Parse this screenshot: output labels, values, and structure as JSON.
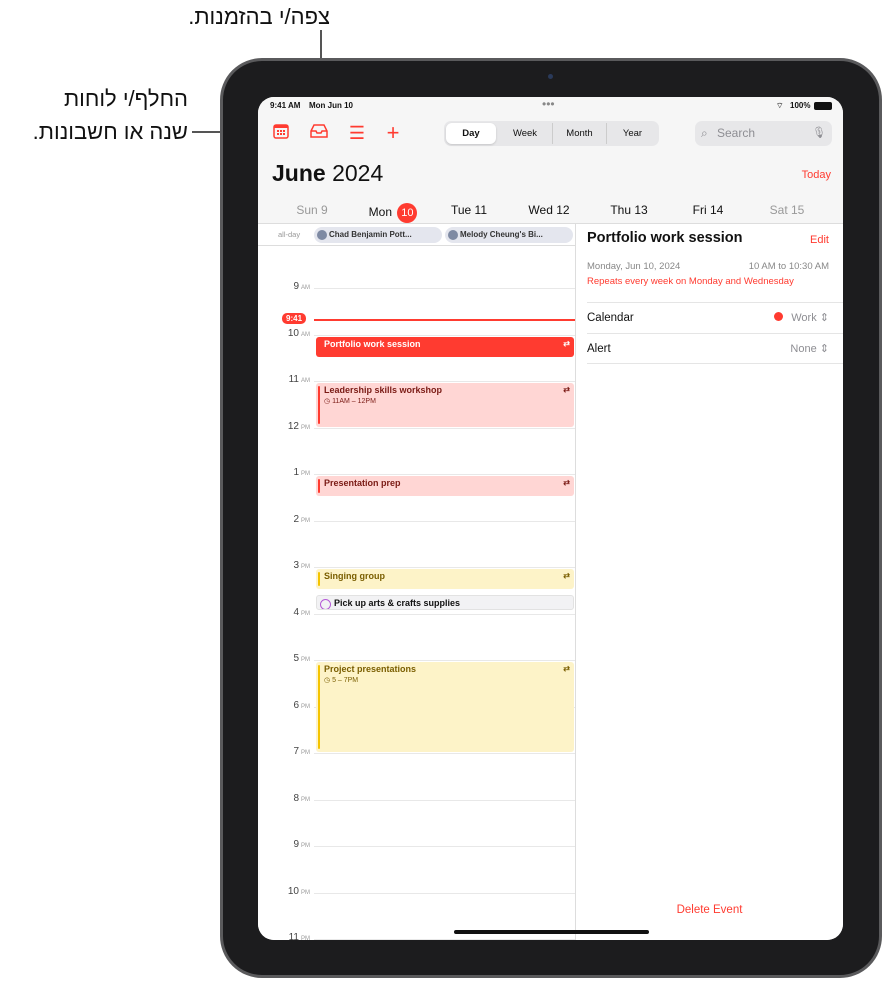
{
  "callouts": {
    "inbox": "צפה/י בהזמנות.",
    "calendars_line1": "החלף/י לוחות",
    "calendars_line2": "שנה או חשבונות."
  },
  "status_bar": {
    "time": "9:41 AM",
    "date": "Mon Jun 10",
    "battery": "100%"
  },
  "toolbar": {
    "icons": [
      "calendar-icon",
      "inbox-icon",
      "list-icon",
      "plus-icon"
    ],
    "view_tabs": [
      {
        "label": "Day",
        "selected": true
      },
      {
        "label": "Week"
      },
      {
        "label": "Month"
      },
      {
        "label": "Year"
      }
    ],
    "search_placeholder": "Search"
  },
  "header": {
    "month": "June",
    "year": "2024",
    "today_label": "Today"
  },
  "week_days": [
    {
      "label": "Sun 9",
      "muted": true
    },
    {
      "label": "Mon",
      "num": "10",
      "selected": true
    },
    {
      "label": "Tue 11"
    },
    {
      "label": "Wed 12"
    },
    {
      "label": "Thu 13"
    },
    {
      "label": "Fri 14"
    },
    {
      "label": "Sat 15",
      "muted": true
    }
  ],
  "all_day": {
    "label": "all-day",
    "events": [
      "Chad Benjamin Pott...",
      "Melody Cheung's Bi..."
    ]
  },
  "current_time": "9:41",
  "hours": [
    {
      "n": "9",
      "p": "AM"
    },
    {
      "n": "10",
      "p": "AM"
    },
    {
      "n": "11",
      "p": "AM"
    },
    {
      "n": "12",
      "p": "PM"
    },
    {
      "n": "1",
      "p": "PM"
    },
    {
      "n": "2",
      "p": "PM"
    },
    {
      "n": "3",
      "p": "PM"
    },
    {
      "n": "4",
      "p": "PM"
    },
    {
      "n": "5",
      "p": "PM"
    },
    {
      "n": "6",
      "p": "PM"
    },
    {
      "n": "7",
      "p": "PM"
    },
    {
      "n": "8",
      "p": "PM"
    },
    {
      "n": "9",
      "p": "PM"
    },
    {
      "n": "10",
      "p": "PM"
    },
    {
      "n": "11",
      "p": "PM"
    }
  ],
  "events": [
    {
      "title": "Portfolio work session",
      "start": 10,
      "end": 10.5,
      "style": "selected"
    },
    {
      "title": "Leadership skills workshop",
      "time": "11AM – 12PM",
      "start": 11,
      "end": 12,
      "style": "red"
    },
    {
      "title": "Presentation prep",
      "start": 13,
      "end": 13.5,
      "style": "red"
    },
    {
      "title": "Singing group",
      "start": 15,
      "end": 15.5,
      "style": "yellow"
    },
    {
      "title": "Pick up arts & crafts supplies",
      "start": 15.55,
      "end": 15.95,
      "style": "reminder"
    },
    {
      "title": "Project presentations",
      "time": "5 – 7PM",
      "start": 17,
      "end": 19,
      "style": "yellow"
    }
  ],
  "detail": {
    "title": "Portfolio work session",
    "edit": "Edit",
    "date": "Monday, Jun 10, 2024",
    "time": "10 AM to 10:30 AM",
    "repeat": "Repeats every week on Monday and Wednesday",
    "calendar_label": "Calendar",
    "calendar_value": "Work",
    "alert_label": "Alert",
    "alert_value": "None",
    "delete": "Delete Event"
  },
  "colors": {
    "accent": "#ff3b30",
    "red_event_bg": "#ffd6d4",
    "red_event_text": "#7a1a14",
    "yellow_event_bg": "#fdf3c8",
    "yellow_event_text": "#7a5e00",
    "yellow_bar": "#f5c400",
    "reminder_ring": "#b45ad6"
  }
}
